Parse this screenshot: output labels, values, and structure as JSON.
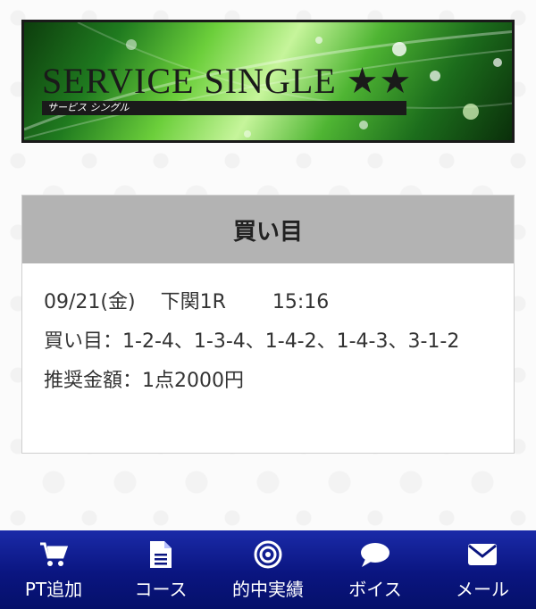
{
  "banner": {
    "title": "SERVICE SINGLE ★★",
    "subtitle": "サービス シングル"
  },
  "card": {
    "header": "買い目",
    "date": "09/21(金)",
    "race": "下関1R",
    "time": "15:16",
    "bets_label": "買い目：",
    "bets": "1-2-4、1-3-4、1-4-2、1-4-3、3-1-2",
    "amount_label": "推奨金額：",
    "amount": "1点2000円"
  },
  "nav": {
    "items": [
      {
        "label": "PT追加",
        "icon": "cart-icon"
      },
      {
        "label": "コース",
        "icon": "document-icon"
      },
      {
        "label": "的中実績",
        "icon": "target-icon"
      },
      {
        "label": "ボイス",
        "icon": "chat-bubble-icon"
      },
      {
        "label": "メール",
        "icon": "mail-icon"
      }
    ],
    "bg_color": "#0a1580"
  }
}
